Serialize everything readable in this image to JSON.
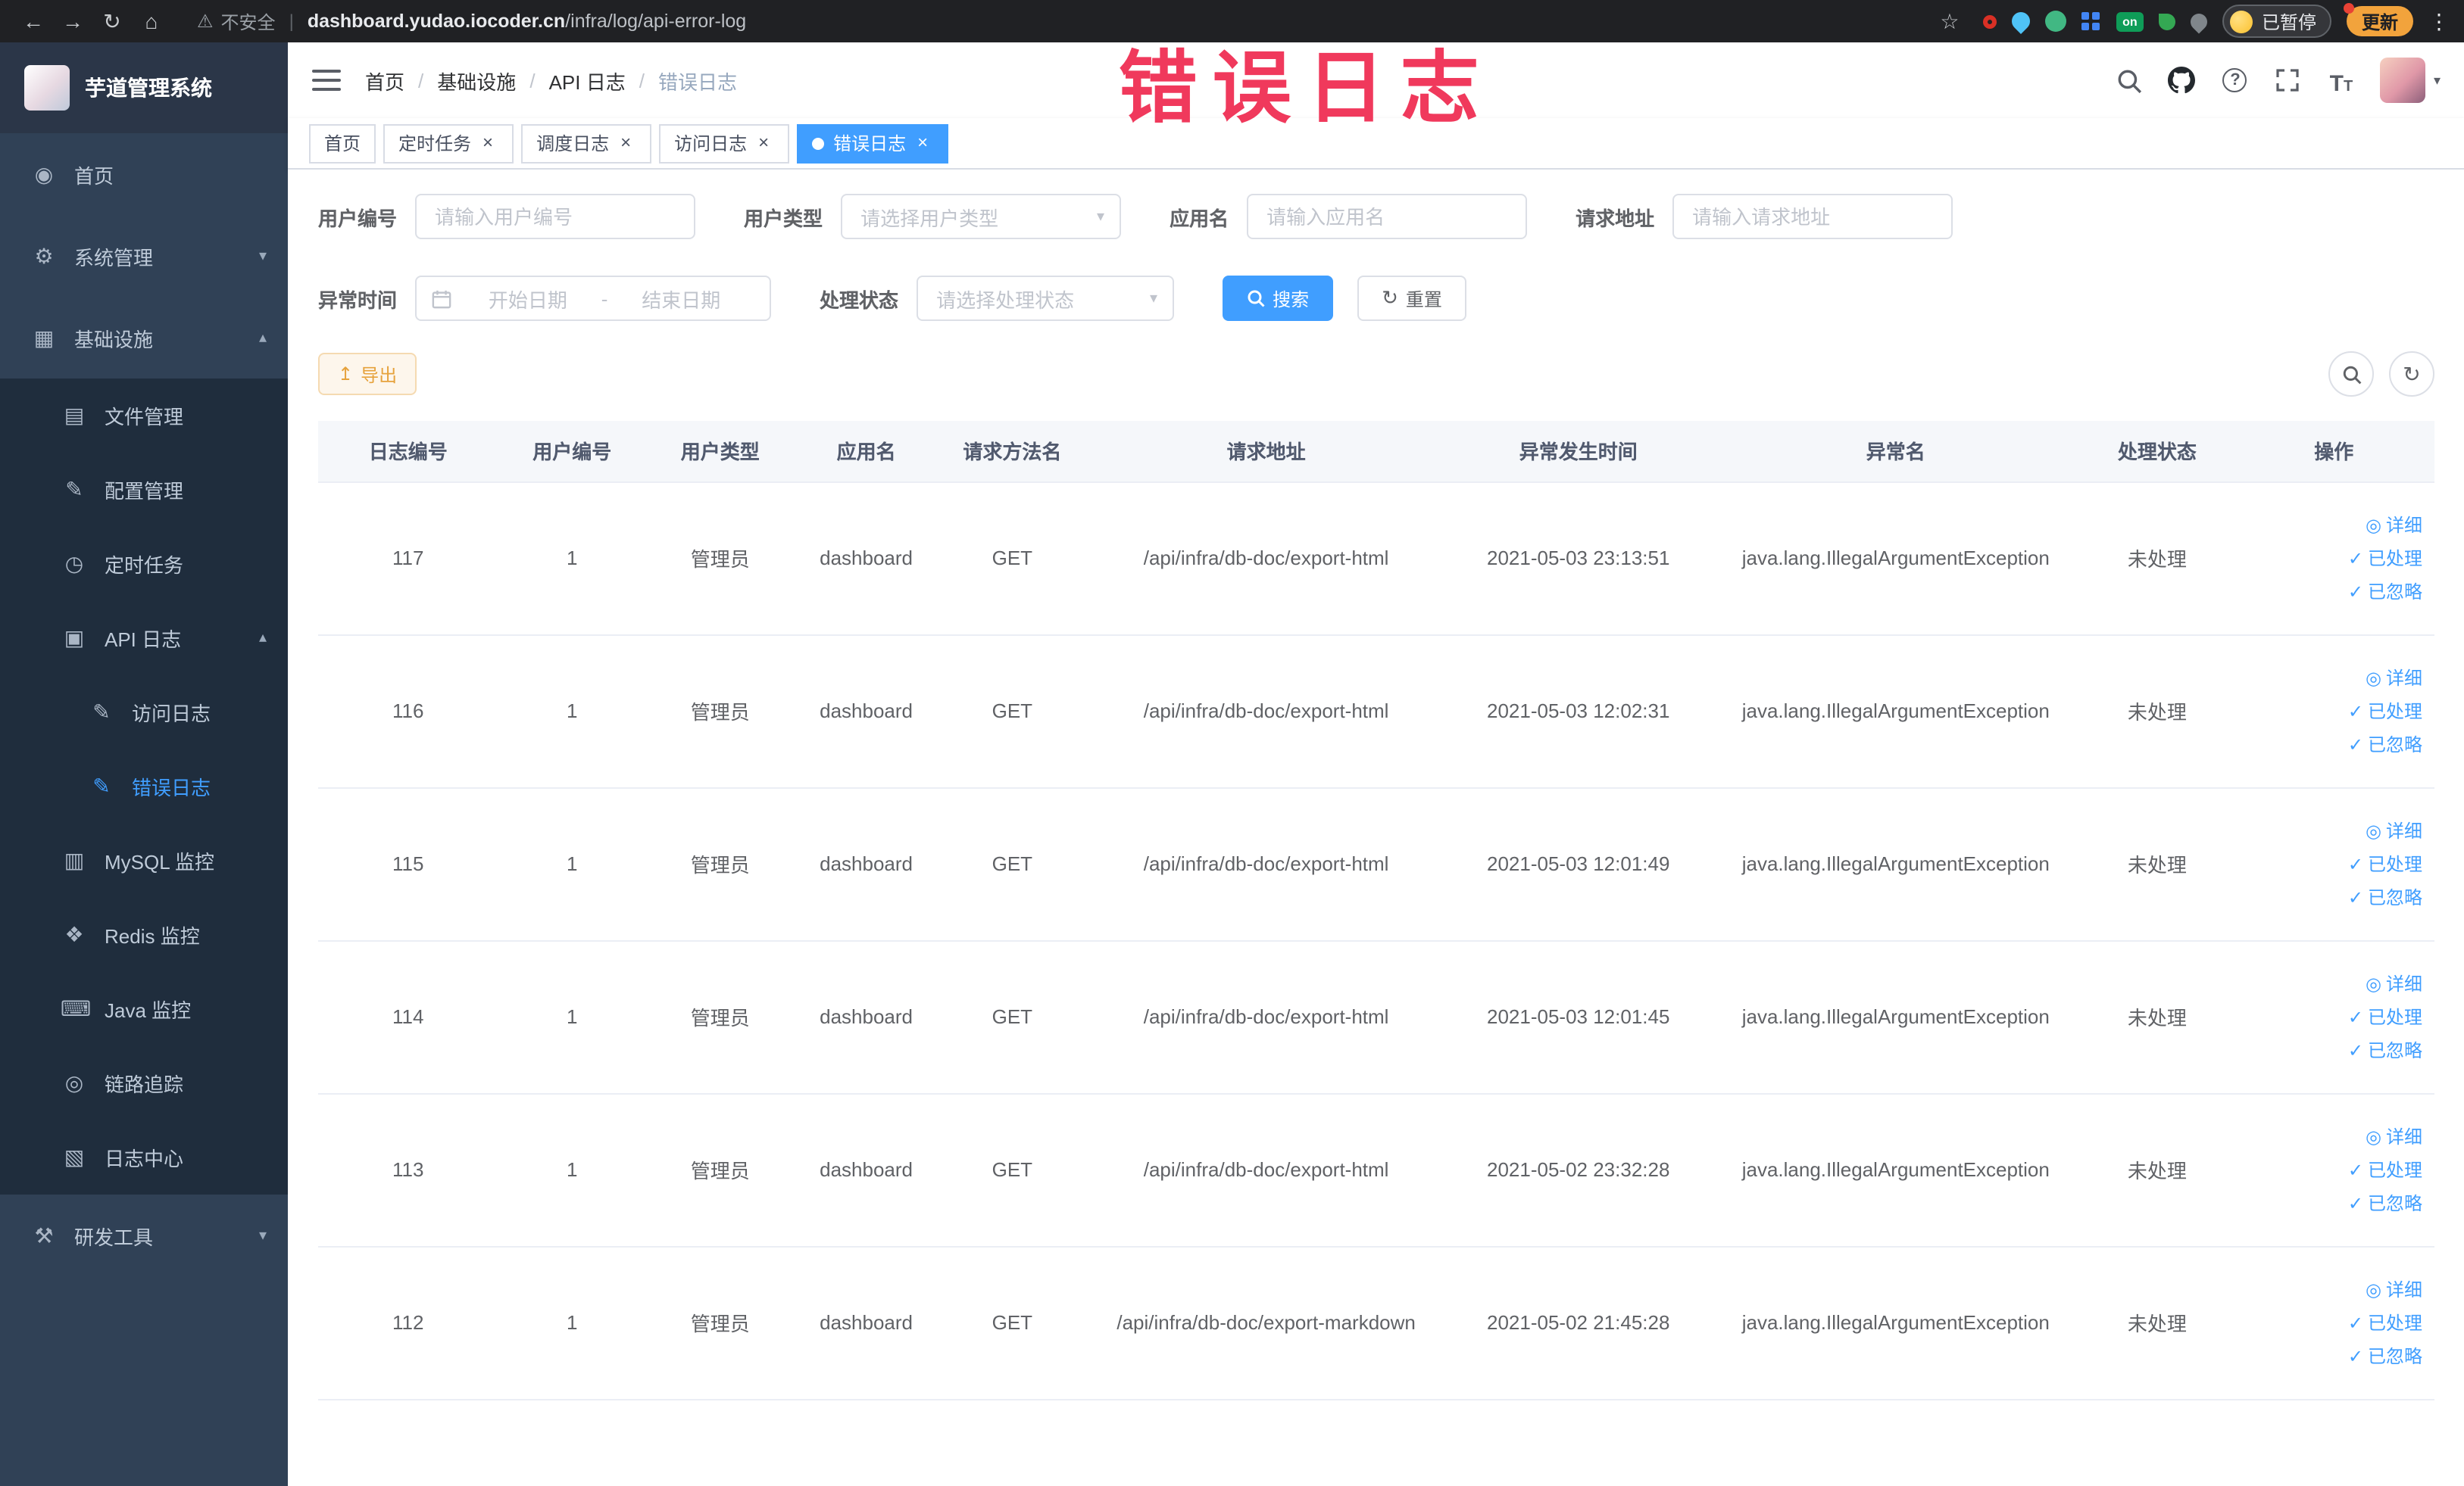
{
  "colors": {
    "accent": "#409eff",
    "warning": "#e6a23c",
    "sidebar_bg": "#304156",
    "submenu_bg": "#1f2d3d",
    "annotation": "#f0395c",
    "extension_colors": [
      "#d93025",
      "#4fc3f7",
      "#41b883",
      "#4285f4",
      "#0f9d58",
      "#34a853",
      "#80868b"
    ]
  },
  "icons": {
    "back": "←",
    "forward": "→",
    "reload": "↻",
    "home": "⌂",
    "warning": "⚠",
    "star": "☆",
    "kebab": "⋮",
    "close": "×",
    "caret_down": "▾",
    "breadcrumb_sep": "/",
    "range_sep": "-",
    "export": "↥",
    "detail": "◎",
    "check": "✓",
    "question": "?",
    "font_big": "T",
    "font_small": "T"
  },
  "browser": {
    "security_label": "不安全",
    "url_domain": "dashboard.yudao.iocoder.cn",
    "url_path": "/infra/log/api-error-log",
    "extension_on_text": "on",
    "profile_label": "已暂停",
    "update_label": "更新"
  },
  "annotation": {
    "text": "错误日志"
  },
  "sidebar": {
    "logo_title": "芋道管理系统",
    "items": [
      {
        "label": "首页",
        "glyph": "◉"
      },
      {
        "label": "系统管理",
        "glyph": "⚙",
        "chevron": "▾"
      },
      {
        "label": "基础设施",
        "glyph": "▦",
        "chevron": "▴"
      },
      {
        "label": "文件管理",
        "glyph": "▤"
      },
      {
        "label": "配置管理",
        "glyph": "✎"
      },
      {
        "label": "定时任务",
        "glyph": "◷"
      },
      {
        "label": "API 日志",
        "glyph": "▣",
        "chevron": "▴"
      },
      {
        "label": "访问日志",
        "glyph": "✎"
      },
      {
        "label": "错误日志",
        "glyph": "✎"
      },
      {
        "label": "MySQL 监控",
        "glyph": "▥"
      },
      {
        "label": "Redis 监控",
        "glyph": "❖"
      },
      {
        "label": "Java 监控",
        "glyph": "⌨"
      },
      {
        "label": "链路追踪",
        "glyph": "◎"
      },
      {
        "label": "日志中心",
        "glyph": "▧"
      },
      {
        "label": "研发工具",
        "glyph": "⚒",
        "chevron": "▾"
      }
    ]
  },
  "header": {
    "breadcrumb": [
      "首页",
      "基础设施",
      "API 日志",
      "错误日志"
    ]
  },
  "tabs": [
    {
      "label": "首页"
    },
    {
      "label": "定时任务"
    },
    {
      "label": "调度日志"
    },
    {
      "label": "访问日志"
    },
    {
      "label": "错误日志"
    }
  ],
  "filters": {
    "user_id": {
      "label": "用户编号",
      "placeholder": "请输入用户编号"
    },
    "user_type": {
      "label": "用户类型",
      "placeholder": "请选择用户类型"
    },
    "app_name": {
      "label": "应用名",
      "placeholder": "请输入应用名"
    },
    "request_url": {
      "label": "请求地址",
      "placeholder": "请输入请求地址"
    },
    "exception_time": {
      "label": "异常时间",
      "start_placeholder": "开始日期",
      "end_placeholder": "结束日期"
    },
    "process_status": {
      "label": "处理状态",
      "placeholder": "请选择处理状态"
    },
    "search_label": "搜索",
    "reset_label": "重置"
  },
  "toolbar": {
    "export_label": "导出"
  },
  "table": {
    "columns": [
      "日志编号",
      "用户编号",
      "用户类型",
      "应用名",
      "请求方法名",
      "请求地址",
      "异常发生时间",
      "异常名",
      "处理状态",
      "操作"
    ],
    "row_actions": [
      "详细",
      "已处理",
      "已忽略"
    ],
    "rows": [
      {
        "log_id": "117",
        "user_id": "1",
        "user_type": "管理员",
        "app_name": "dashboard",
        "method": "GET",
        "url": "/api/infra/db-doc/export-html",
        "time": "2021-05-03 23:13:51",
        "exception": "java.lang.IllegalArgumentException",
        "status": "未处理"
      },
      {
        "log_id": "116",
        "user_id": "1",
        "user_type": "管理员",
        "app_name": "dashboard",
        "method": "GET",
        "url": "/api/infra/db-doc/export-html",
        "time": "2021-05-03 12:02:31",
        "exception": "java.lang.IllegalArgumentException",
        "status": "未处理"
      },
      {
        "log_id": "115",
        "user_id": "1",
        "user_type": "管理员",
        "app_name": "dashboard",
        "method": "GET",
        "url": "/api/infra/db-doc/export-html",
        "time": "2021-05-03 12:01:49",
        "exception": "java.lang.IllegalArgumentException",
        "status": "未处理"
      },
      {
        "log_id": "114",
        "user_id": "1",
        "user_type": "管理员",
        "app_name": "dashboard",
        "method": "GET",
        "url": "/api/infra/db-doc/export-html",
        "time": "2021-05-03 12:01:45",
        "exception": "java.lang.IllegalArgumentException",
        "status": "未处理"
      },
      {
        "log_id": "113",
        "user_id": "1",
        "user_type": "管理员",
        "app_name": "dashboard",
        "method": "GET",
        "url": "/api/infra/db-doc/export-html",
        "time": "2021-05-02 23:32:28",
        "exception": "java.lang.IllegalArgumentException",
        "status": "未处理"
      },
      {
        "log_id": "112",
        "user_id": "1",
        "user_type": "管理员",
        "app_name": "dashboard",
        "method": "GET",
        "url": "/api/infra/db-doc/export-markdown",
        "time": "2021-05-02 21:45:28",
        "exception": "java.lang.IllegalArgumentException",
        "status": "未处理"
      }
    ]
  }
}
